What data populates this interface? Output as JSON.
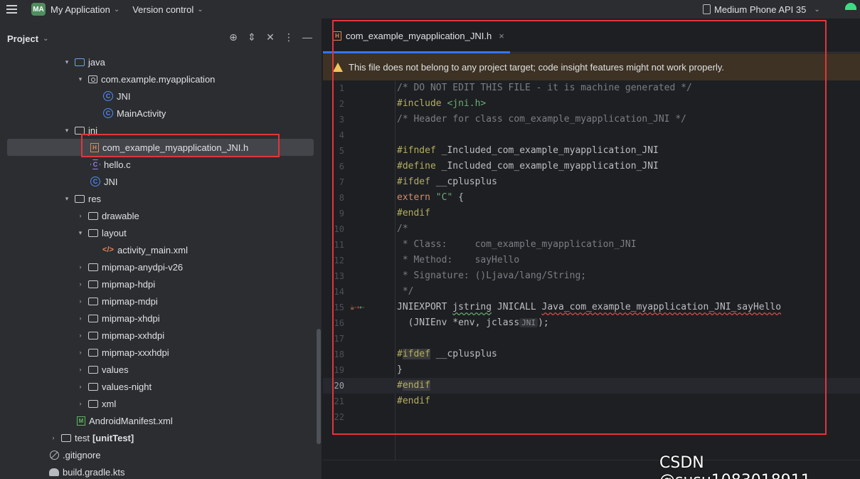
{
  "topbar": {
    "project_badge": "MA",
    "project_name": "My Application",
    "vcs": "Version control",
    "device": "Medium Phone API 35"
  },
  "project_panel": {
    "title": "Project",
    "tree": [
      {
        "label": "java",
        "icon": "folder-blue-icon",
        "expanded": true
      },
      {
        "label": "com.example.myapplication",
        "icon": "package-icon",
        "expanded": true
      },
      {
        "label": "JNI",
        "icon": "class-icon"
      },
      {
        "label": "MainActivity",
        "icon": "class-icon"
      },
      {
        "label": "jni",
        "icon": "folder-icon",
        "expanded": true
      },
      {
        "label": "com_example_myapplication_JNI.h",
        "icon": "header-file-icon",
        "selected": true
      },
      {
        "label": "hello.c",
        "icon": "c-file-icon"
      },
      {
        "label": "JNI",
        "icon": "class-icon"
      },
      {
        "label": "res",
        "icon": "folder-icon",
        "expanded": true
      },
      {
        "label": "drawable",
        "icon": "folder-icon",
        "expanded": false
      },
      {
        "label": "layout",
        "icon": "folder-icon",
        "expanded": true
      },
      {
        "label": "activity_main.xml",
        "icon": "xml-file-icon"
      },
      {
        "label": "mipmap-anydpi-v26",
        "icon": "folder-icon",
        "expanded": false
      },
      {
        "label": "mipmap-hdpi",
        "icon": "folder-icon",
        "expanded": false
      },
      {
        "label": "mipmap-mdpi",
        "icon": "folder-icon",
        "expanded": false
      },
      {
        "label": "mipmap-xhdpi",
        "icon": "folder-icon",
        "expanded": false
      },
      {
        "label": "mipmap-xxhdpi",
        "icon": "folder-icon",
        "expanded": false
      },
      {
        "label": "mipmap-xxxhdpi",
        "icon": "folder-icon",
        "expanded": false
      },
      {
        "label": "values",
        "icon": "folder-icon",
        "expanded": false
      },
      {
        "label": "values-night",
        "icon": "folder-icon",
        "expanded": false
      },
      {
        "label": "xml",
        "icon": "folder-icon",
        "expanded": false
      },
      {
        "label": "AndroidManifest.xml",
        "icon": "manifest-icon"
      },
      {
        "label": "test",
        "label_suffix": "[unitTest]",
        "icon": "folder-icon",
        "expanded": false
      },
      {
        "label": ".gitignore",
        "icon": "gitignore-icon"
      },
      {
        "label": "build.gradle.kts",
        "icon": "gradle-icon"
      }
    ]
  },
  "editor": {
    "tab_label": "com_example_myapplication_JNI.h",
    "tab_close": "×",
    "banner": "This file does not belong to any project target; code insight features might not work properly.",
    "current_line": 20,
    "line_numbers": [
      "1",
      "2",
      "3",
      "4",
      "5",
      "6",
      "7",
      "8",
      "9",
      "10",
      "11",
      "12",
      "13",
      "14",
      "15",
      "16",
      "17",
      "18",
      "19",
      "20",
      "21",
      "22"
    ],
    "code": {
      "l1": "/* DO NOT EDIT THIS FILE - it is machine generated */",
      "l2_kw": "#include ",
      "l2_str": "<jni.h>",
      "l3": "/* Header for class com_example_myapplication_JNI */",
      "l5_kw": "#ifndef ",
      "l5_rest": "_Included_com_example_myapplication_JNI",
      "l6_kw": "#define ",
      "l6_rest": "_Included_com_example_myapplication_JNI",
      "l7_kw": "#ifdef ",
      "l7_rest": "__cplusplus",
      "l8_kw": "extern ",
      "l8_str": "\"C\"",
      "l8_rest": " {",
      "l9": "#endif",
      "l10": "/*",
      "l11": " * Class:     com_example_myapplication_JNI",
      "l12": " * Method:    sayHello",
      "l13": " * Signature: ()Ljava/lang/String;",
      "l14": " */",
      "l15_a": "JNIEXPORT ",
      "l15_b": "jstring",
      "l15_c": " JNICALL ",
      "l15_d": "Java_com_example_myapplication_JNI_sayHello",
      "l16_a": "  (JNIEnv *env, jclass",
      "l16_hint": "JNI",
      "l16_b": ");",
      "l18_a": "#",
      "l18_b": "ifdef",
      "l18_c": " __cplusplus",
      "l19": "}",
      "l20_a": "#",
      "l20_b": "endif",
      "l21": "#endif"
    }
  },
  "watermark": "CSDN @susu1083018911",
  "colors": {
    "accent": "#3574f0",
    "annotation": "#e0363c",
    "warning_bg": "#3d3223"
  }
}
